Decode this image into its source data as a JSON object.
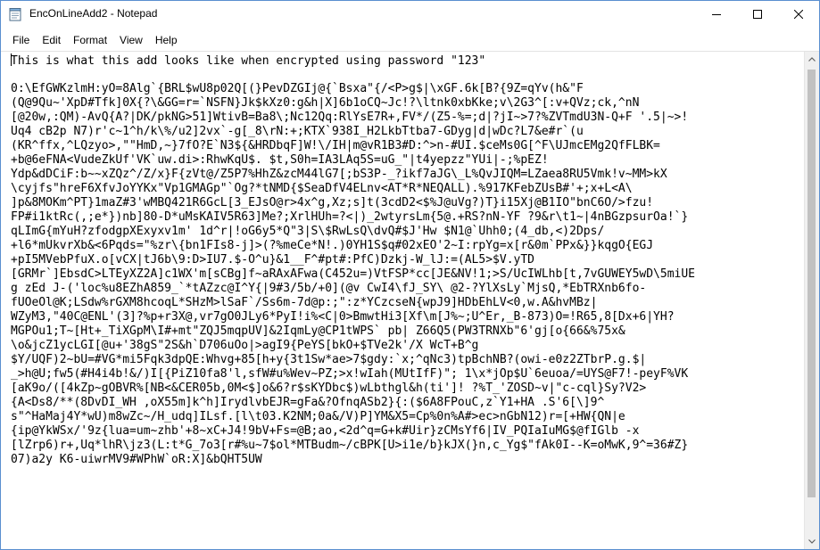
{
  "window": {
    "title": "EncOnLineAdd2 - Notepad"
  },
  "menu": [
    "File",
    "Edit",
    "Format",
    "View",
    "Help"
  ],
  "document": {
    "lines": [
      "This is what this add looks like when encrypted using password \"123\"",
      "",
      "0:\\EfGWKzlmH:yO=8Alg`{BRL$wU8p02Q[(}PevDZGIj@{`Bsxa\"{/<P>g$|\\xGF.6k[B?{9Z=qYv(h&\"F",
      "(Q@9Qu~'XpD#Tfk]0X{?\\&GG=r=`NSFN}Jk$kXz0:g&h|X]6b1oCQ~Jc!?\\ltnk0xbKke;v\\2G3^[:v+QVz;ck,^nN",
      "[@20w,:QM)-AvQ{A?|DK/pkNG>51]WtivB=Ba8\\;Nc12Qq:RlYsE7R+,FV*/(Z5-%=;d|?jI~>7?%ZVTmdU3N-Q+F '.5|~>!",
      "Uq4 cB2p N7)r'c~1^h/k\\%/u2]2vx`-g[_8\\rN:+;KTX`938I_H2LkbTtba7-GDyg|d|wDc?L7&e#r`(u",
      "(KR^ffx,^LQzyo>,\"\"HmD,~}7fO?E`N3${&HRDbqF]W!\\/IH|m@vR1B3#D:^>n-#UI.$ceMs0G[^F\\UJmcEMg2QfFLBK=",
      "+b@6eFNA<VudeZkUf'VK`uw.di>:RhwKqU$. $t,S0h=IA3LAq5S=uG_\"|t4yepzz\"YUi|-;%pEZ!",
      "Ydp&dDCiF:b~~xZQz^/Z/x}F{zVt@/Z5P7%HhZ&zcM44lG7[;bS3P-_?ikf7aJG\\_L%QvJIQM=LZaea8RU5Vmk!v~MM>kX",
      "\\cyjfs\"hreF6XfvJoYYKx\"Vp1GMAGp\"`Og?*tNMD{$SeaDfV4ELnv<AT*R*NEQALL).%917KFebZUsB#'+;x+L<A\\",
      "]p&8MOKm^PT}1maZ#3'wMBQ421R6GcL[3_EJsO@r>4x^g,Xz;s]t(3cdD2<$%J@uVg?)T}i15Xj@B1IO\"bnC6O/>fzu!",
      "FP#i1ktRc(,;e*})nb]80-D*uMsKAIV5R63]Me?;XrlHUh=?<|)_2wtyrsLm{5@.+RS?nN-YF ?9&r\\t1~|4nBGzpsurOa!`}",
      "qLImG{mYuH?zfodgpXExyxv1m' 1d^r|!oG6y5*Q\"3|S\\$RwLsQ\\dvQ#$J'Hw $N1@`Uhh0;(4_db,<)2Dps/",
      "+l6*mUkvrXb&<6Pqds=\"%zr\\{bn1FIs8-j]>(?%meCe*N!.)0YH1S$q#02xEO'2~I:rpYg=x[r&0m`PPx&}}kqgO{EGJ",
      "+pI5MVebPfuX.o[vCX|tJ6b\\9:D>IU7.$-O^u}&1__F^#pt#:PfC)Dzkj-W_lJ:=(AL5>$V.yTD",
      "[GRMr`]EbsdC>LTEyXZ2A]c1WX'm[sCBg]f~aRAxAFwa(C452u=)VtFSP*cc[JE&NV!1;>S/UcIWLhb[t,7vGUWEY5wD\\5miUE",
      "g zEd J-('loc%u8EZhA859_`*tAZzc@I^Y{|9#3/5b/+0](@v CwI4\\fJ_SY\\ @2-?YlXsLy`MjsQ,*EbTRXnb6fo-",
      "fUOeOl@K;LSdw%rGXM8hcoqL*SHzM>lSaF`/Ss6m-7d@p:;\":z*YCzcseN{wpJ9]HDbEhLV<0,w.A&hvMBz|",
      "WZyM3,\"40C@ENL'(3]?%p+r3X@,vr7gO0JLy6*PyI!i%<C|0>BmwtHi3[Xf\\m[J%~;U^Er,_B-873)O=!R65,8[Dx+6|YH?",
      "MGPOu1;T~[Ht+_TiXGpM\\I#+mt\"ZQJ5mqpUV]&2IqmLy@CP1tWPS` pb| Z66Q5(PW3TRNXb\"6'gj[o{66&%75x&",
      "\\o&jcZ1ycLGI[@u+'38gS\"2S&h`D706uOo|>agI9{PeYS[bkO+$TVe2k'/X WcT+B^g",
      "$Y/UQF)2~bU=#VG*mi5Fqk3dpQE:Whvg+85[h+y{3t1Sw*ae>7$gdy:`x;^qNc3)tpBchNB?(owi-e0z2ZTbrP.g.$|",
      "_>h@U;fw5(#H4i4b!&/)I[{PiZ10fa8'l,sfW#u%Wev~PZ;>x!wIah(MUtIfF)\"; 1\\x*jOp$U`6euoa/=UYS@F7!-peyF%VK",
      "[aK9o/([4kZp~gOBVR%[NB<&CER05b,0M<$]o&6?r$sKYDbc$)wLbthgl&h(ti']! ?%T_'ZOSD~v|\"c-cql}Sy?V2>",
      "{A<Ds8/**(8DvDI_WH ,oX55m]k^h]IrydlvbEJR=gFa&?OfnqASb2}{:($6A8FPouC,z`Y1+HA .S'6[\\]9^",
      "s\"^HaMaj4Y*wU)m8wZc~/H_udq]ILsf.[l\\t03.K2NM;0a&/V)P]YM&X5=Cp%0n%A#>ec>nGbN12)r=[+HW{QN|e",
      "{ip@YkWSx/'9z{lua=um~zhb'+8~xC+J4!9bV+Fs=@B;ao,<2d^q=G+k#Uir}zCMsYf6|IV_PQIaIuMG$@fIGlb -x",
      "[lZrp6)r+,Uq*lhR\\jz3(L:t*G_7o3[r#%u~7$ol*MTBudm~/cBPK[U>i1e/b}kJX(}n,c_Yg$\"fAk0I--K=oMwK,9^=36#Z}",
      "07)a2y K6-uiwrMV9#WPhW`oR:X]&bQHT5UW"
    ]
  }
}
